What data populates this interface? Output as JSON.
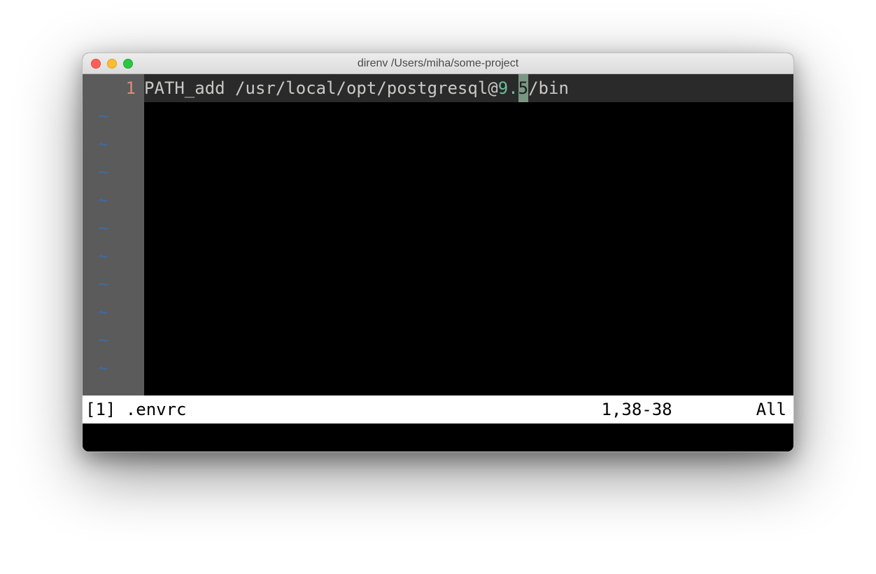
{
  "window": {
    "title": "direnv  /Users/miha/some-project"
  },
  "editor": {
    "line_number": "1",
    "tilde": "~",
    "tilde_rows": 11,
    "code": {
      "prefix": "PATH_add /usr/local/opt/postgresql@",
      "num_whole": "9",
      "num_dot": ".",
      "cursor_char": "5",
      "suffix": "/bin"
    }
  },
  "status": {
    "left": "[1] .envrc",
    "position": "1,38-38",
    "scroll": "All"
  }
}
